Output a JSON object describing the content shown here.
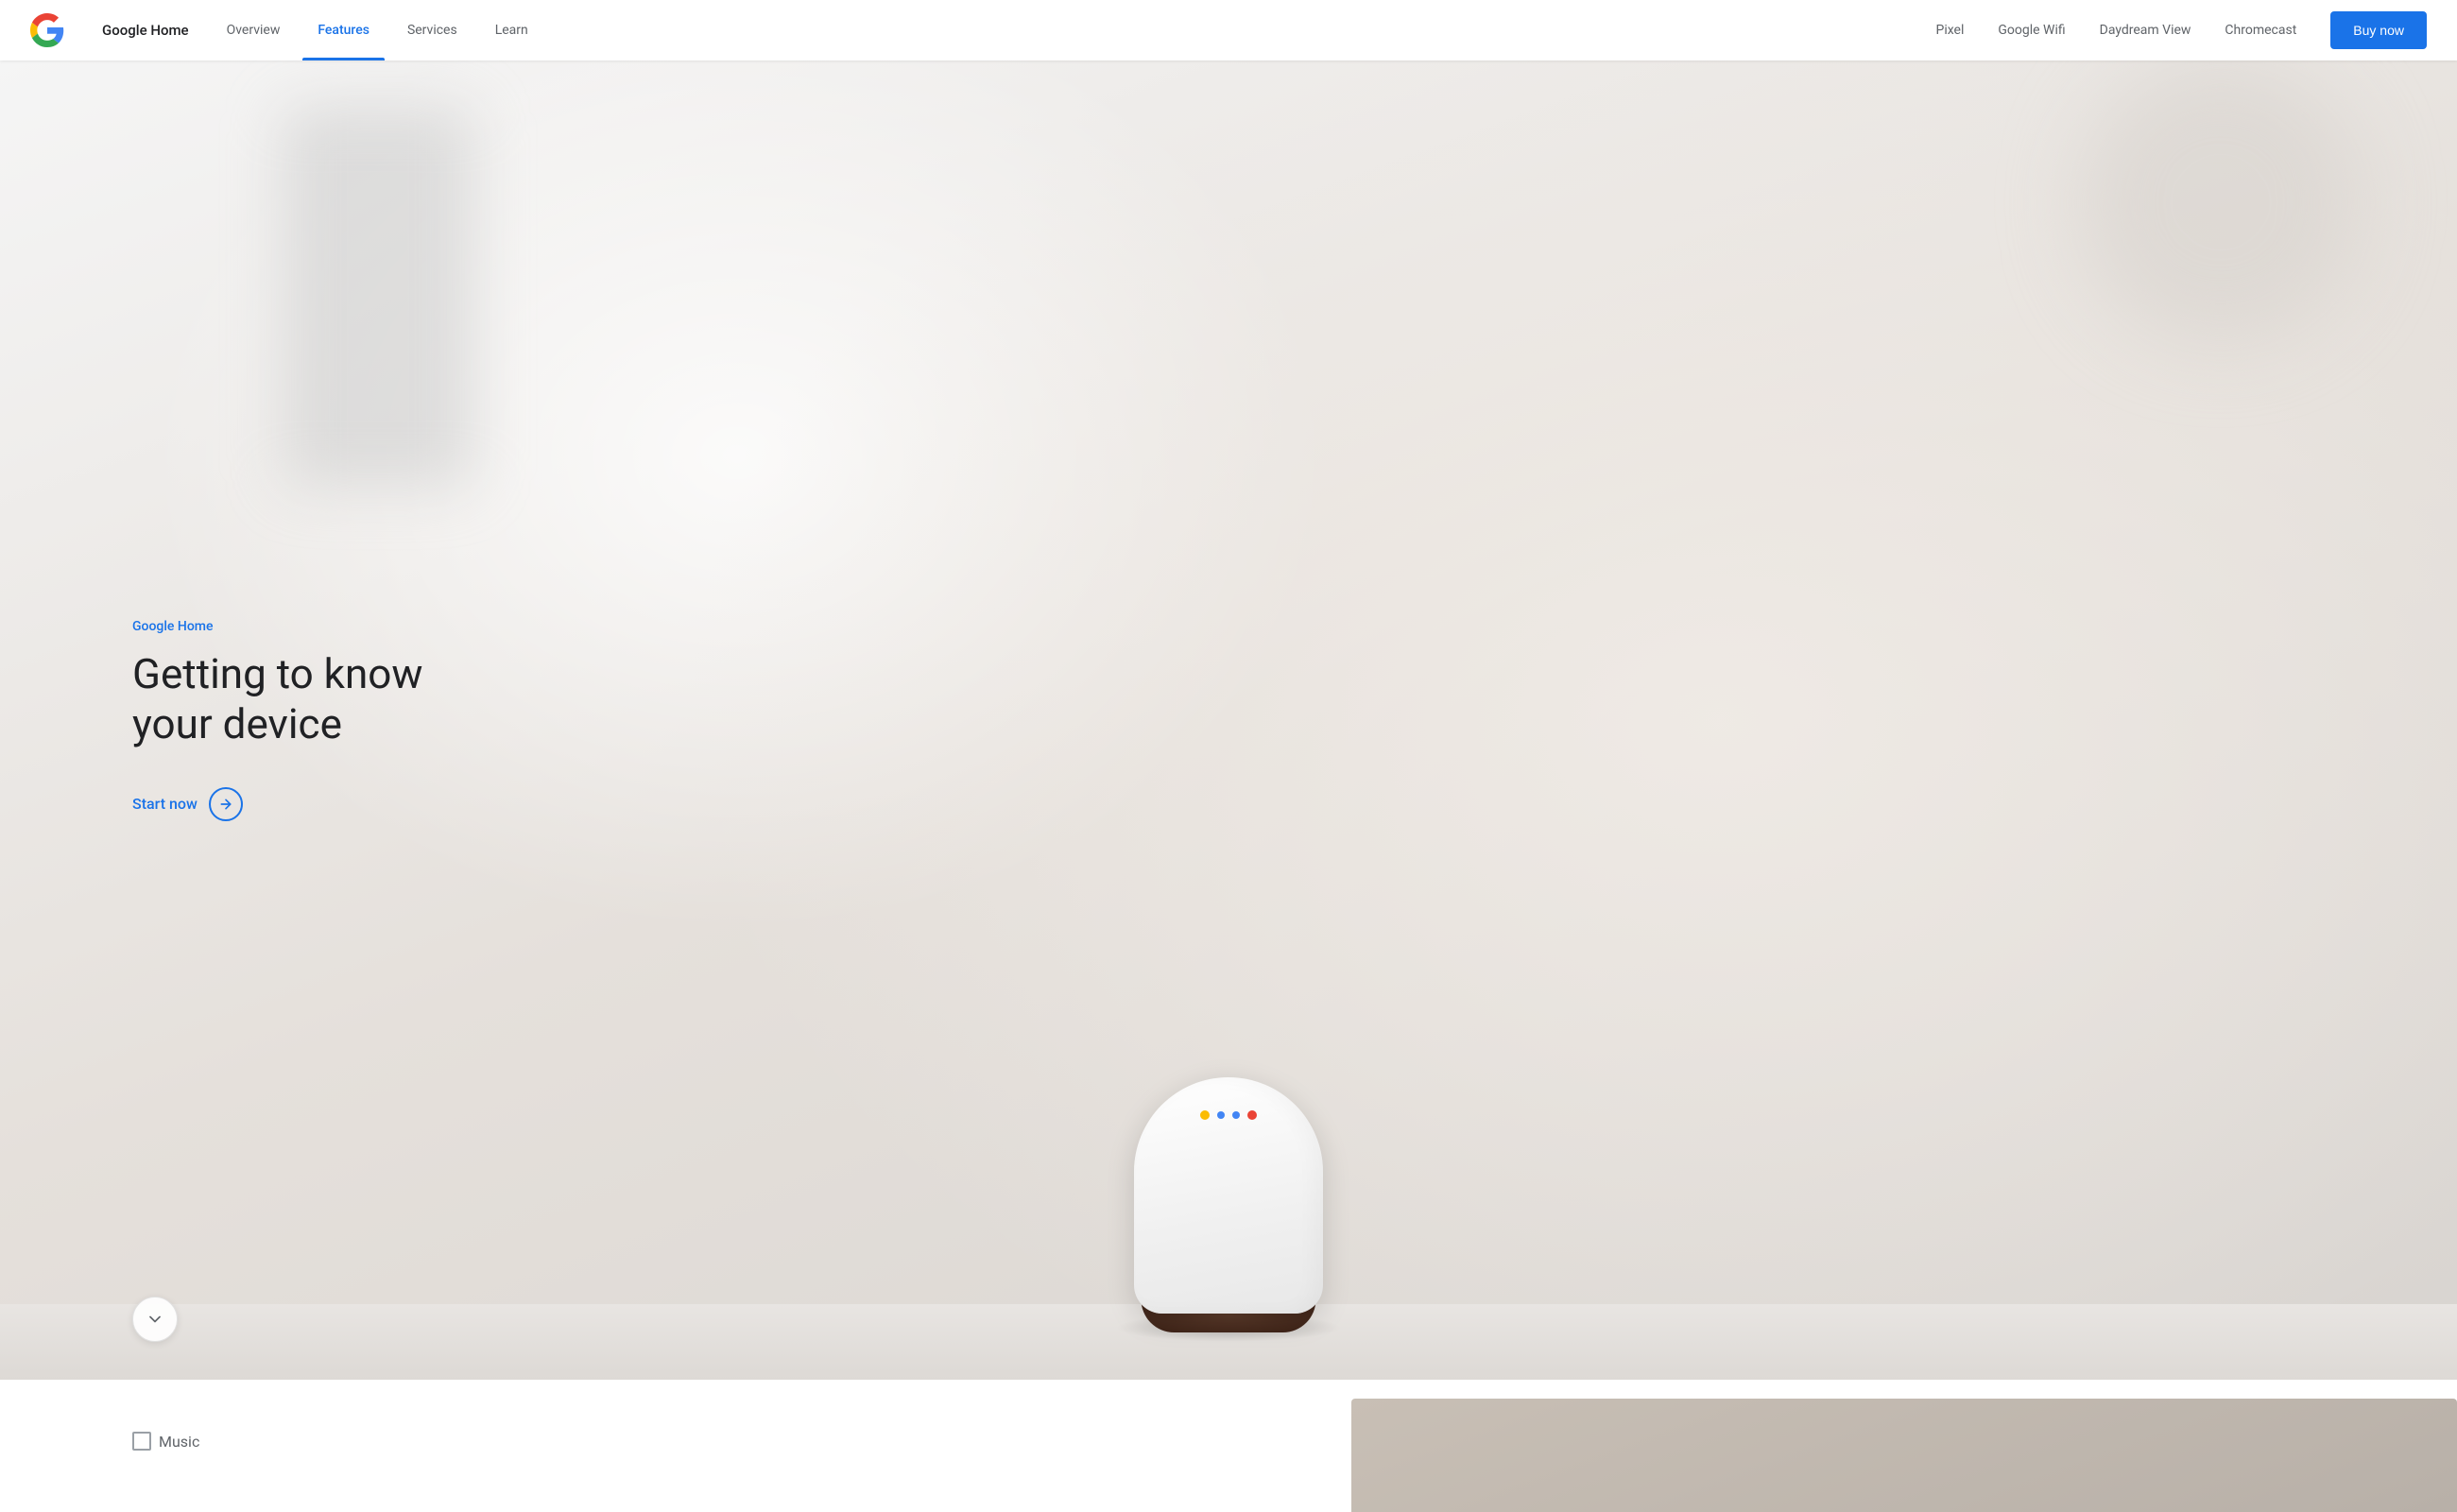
{
  "nav": {
    "logo_alt": "Google",
    "brand_label": "Google Home",
    "items": [
      {
        "id": "overview",
        "label": "Overview",
        "active": false
      },
      {
        "id": "features",
        "label": "Features",
        "active": true
      },
      {
        "id": "services",
        "label": "Services",
        "active": false
      },
      {
        "id": "learn",
        "label": "Learn",
        "active": false
      }
    ],
    "right_items": [
      {
        "id": "pixel",
        "label": "Pixel"
      },
      {
        "id": "google-wifi",
        "label": "Google Wifi"
      },
      {
        "id": "daydream-view",
        "label": "Daydream View"
      },
      {
        "id": "chromecast",
        "label": "Chromecast"
      }
    ],
    "buy_label": "Buy now"
  },
  "hero": {
    "label": "Google Home",
    "title": "Getting to know your device",
    "cta_label": "Start now",
    "cta_arrow": "→"
  },
  "scroll": {
    "icon": "chevron-down"
  },
  "below": {
    "music_label": "Music"
  },
  "colors": {
    "blue": "#1a73e8",
    "text_dark": "#202124",
    "text_mid": "#5f6368",
    "active_underline": "#1a73e8"
  }
}
